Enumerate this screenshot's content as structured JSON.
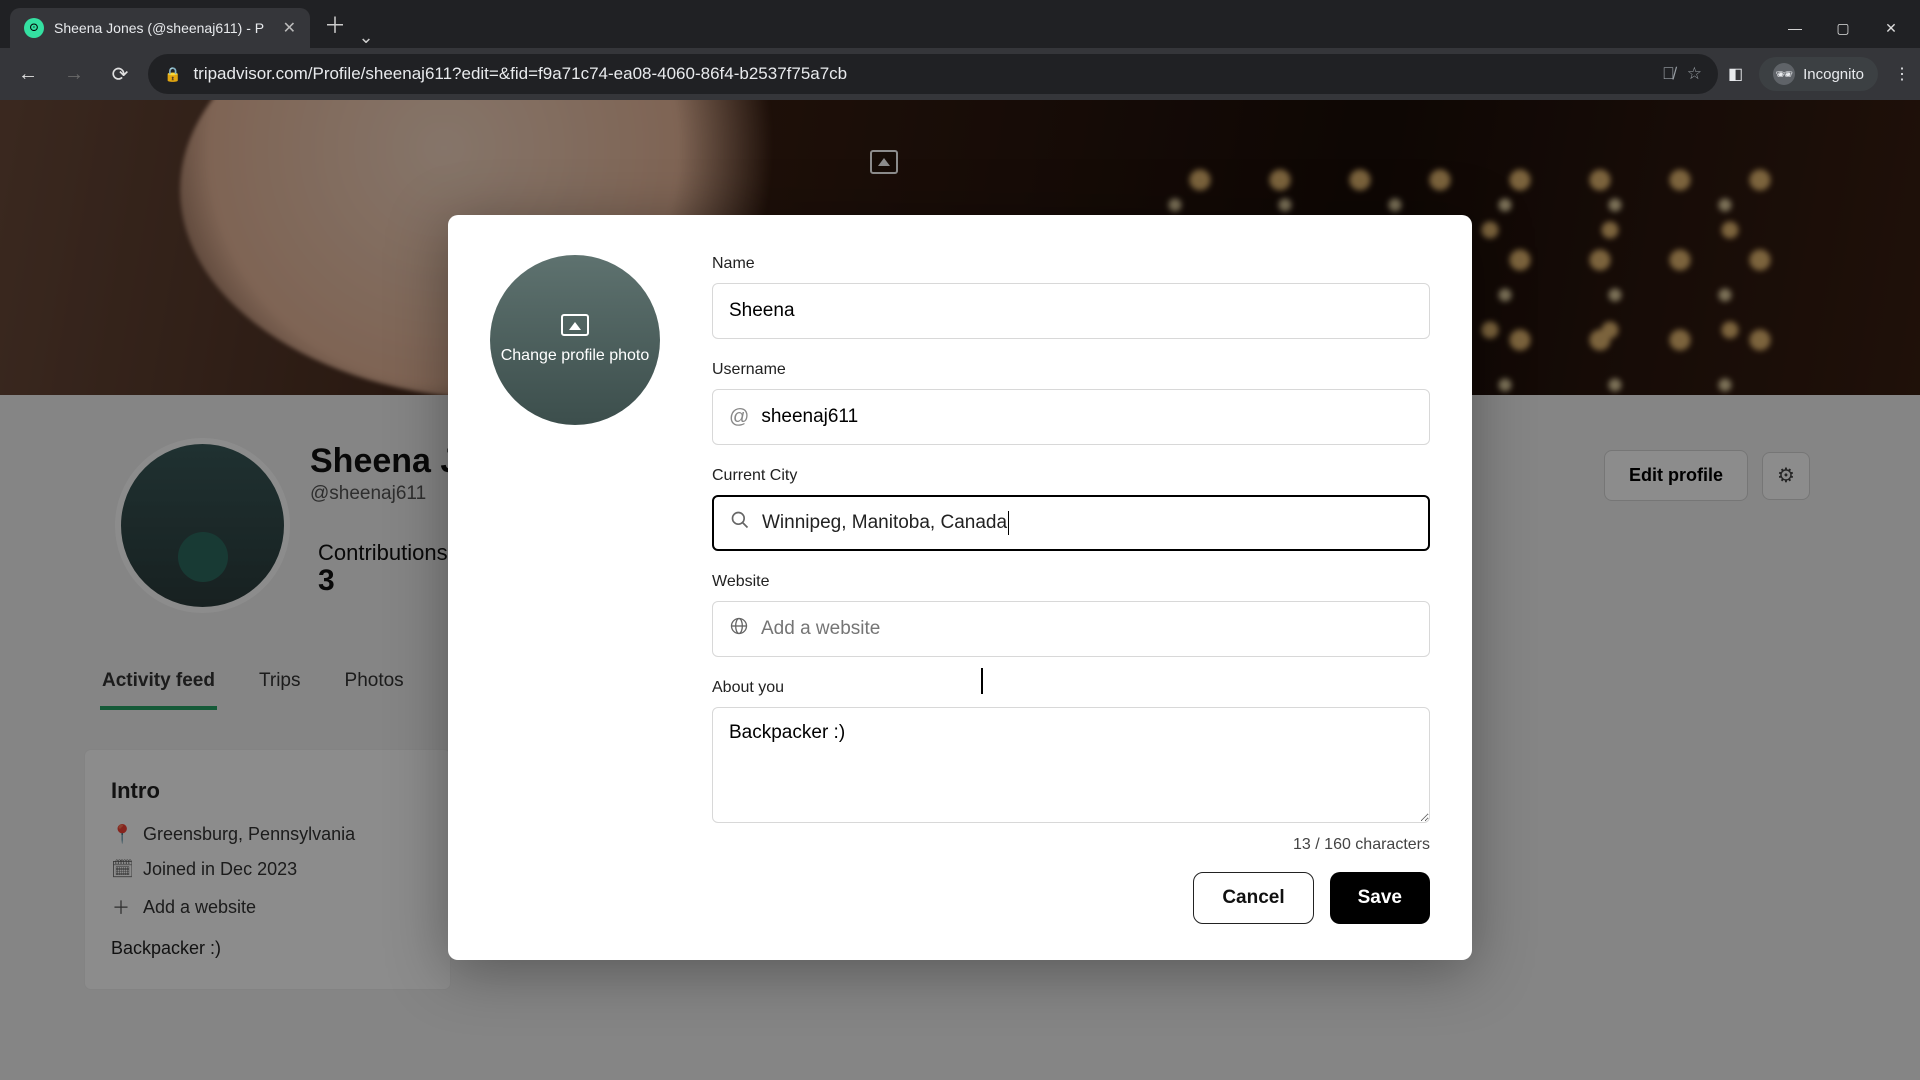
{
  "browser": {
    "tab_title": "Sheena Jones (@sheenaj611) - P",
    "url": "tripadvisor.com/Profile/sheenaj611?edit=&fid=f9a71c74-ea08-4060-86f4-b2537f75a7cb",
    "incognito_label": "Incognito"
  },
  "profile": {
    "display_name": "Sheena J",
    "handle": "@sheenaj611",
    "contributions_label": "Contributions",
    "contributions_count": "3",
    "edit_profile_label": "Edit profile",
    "tabs": [
      "Activity feed",
      "Trips",
      "Photos"
    ],
    "intro": {
      "heading": "Intro",
      "location": "Greensburg, Pennsylvania",
      "joined": "Joined in Dec 2023",
      "add_website": "Add a website",
      "bio": "Backpacker :)"
    }
  },
  "modal": {
    "change_photo_label": "Change profile photo",
    "fields": {
      "name": {
        "label": "Name",
        "value": "Sheena"
      },
      "username": {
        "label": "Username",
        "value": "sheenaj611"
      },
      "city": {
        "label": "Current City",
        "value": "Winnipeg, Manitoba, Canada"
      },
      "website": {
        "label": "Website",
        "placeholder": "Add a website",
        "value": ""
      },
      "about": {
        "label": "About you",
        "value": "Backpacker :)"
      }
    },
    "char_counter": "13 / 160 characters",
    "cancel_label": "Cancel",
    "save_label": "Save"
  }
}
